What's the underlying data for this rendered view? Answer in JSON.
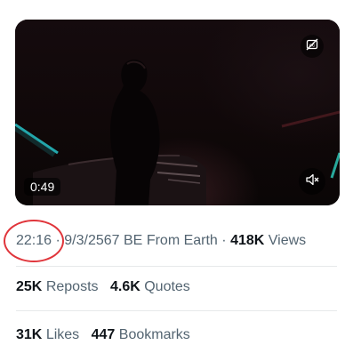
{
  "video": {
    "duration": "0:49",
    "icons": {
      "captions": "captions-off-icon",
      "mute": "muted-speaker-icon"
    }
  },
  "meta": {
    "time": "22:16",
    "separator1": "·",
    "date": "9/3/2567 BE",
    "source": "From Earth",
    "separator2": "·",
    "views_count": "418K",
    "views_label": "Views"
  },
  "stats": {
    "reposts_count": "25K",
    "reposts_label": "Reposts",
    "quotes_count": "4.6K",
    "quotes_label": "Quotes",
    "likes_count": "31K",
    "likes_label": "Likes",
    "bookmarks_count": "447",
    "bookmarks_label": "Bookmarks"
  },
  "colors": {
    "annotation_circle": "#e0353b",
    "text_primary": "#0f1419",
    "text_secondary": "#536471"
  }
}
